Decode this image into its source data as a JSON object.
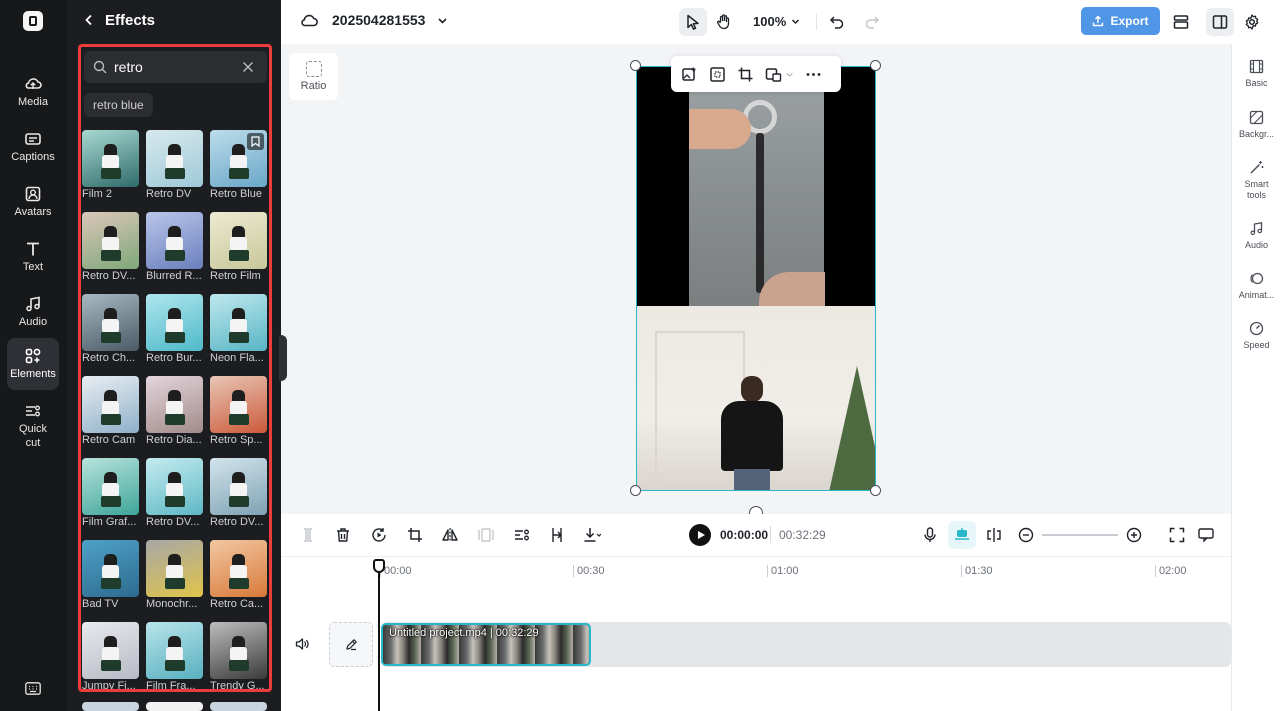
{
  "rail": {
    "items": [
      {
        "label": "Media",
        "icon": "media-cloud-icon"
      },
      {
        "label": "Captions",
        "icon": "captions-icon"
      },
      {
        "label": "Avatars",
        "icon": "avatar-icon"
      },
      {
        "label": "Text",
        "icon": "text-icon"
      },
      {
        "label": "Audio",
        "icon": "music-note-icon"
      },
      {
        "label": "Elements",
        "icon": "elements-icon",
        "active": true
      },
      {
        "label": "Quick cut",
        "icon": "quick-cut-icon"
      }
    ]
  },
  "effects_panel": {
    "title": "Effects",
    "search": {
      "value": "retro",
      "placeholder": "Search"
    },
    "suggestion_chip": "retro blue",
    "tiles": [
      {
        "label": "Film 2"
      },
      {
        "label": "Retro DV"
      },
      {
        "label": "Retro Blue"
      },
      {
        "label": "Retro DV..."
      },
      {
        "label": "Blurred R..."
      },
      {
        "label": "Retro Film"
      },
      {
        "label": "Retro Ch..."
      },
      {
        "label": "Retro Bur..."
      },
      {
        "label": "Neon Fla..."
      },
      {
        "label": "Retro Cam"
      },
      {
        "label": "Retro Dia..."
      },
      {
        "label": "Retro Sp..."
      },
      {
        "label": "Film Graf..."
      },
      {
        "label": "Retro DV..."
      },
      {
        "label": "Retro DV..."
      },
      {
        "label": "Bad TV"
      },
      {
        "label": "Monochr..."
      },
      {
        "label": "Retro Ca..."
      },
      {
        "label": "Jumpy Fi..."
      },
      {
        "label": "Film Fra..."
      },
      {
        "label": "Trendy G..."
      }
    ]
  },
  "topbar": {
    "project_name": "202504281553",
    "zoom": "100%",
    "export_label": "Export"
  },
  "canvas": {
    "ratio_label": "Ratio"
  },
  "right_panel": {
    "items": [
      {
        "label": "Basic"
      },
      {
        "label": "Backgr..."
      },
      {
        "label": "Smart tools"
      },
      {
        "label": "Audio"
      },
      {
        "label": "Animat..."
      },
      {
        "label": "Speed"
      }
    ]
  },
  "player": {
    "current_time": "00:00:00",
    "total_time": "00:32:29"
  },
  "timeline": {
    "ticks": [
      "00:00",
      "00:30",
      "01:00",
      "01:30",
      "02:00"
    ],
    "clip_label": "Untitled project.mp4 | 00:32:29"
  },
  "colors": {
    "accent": "#28b7c9",
    "export_button": "#4f96e6",
    "highlight": "#ee3b3b"
  }
}
